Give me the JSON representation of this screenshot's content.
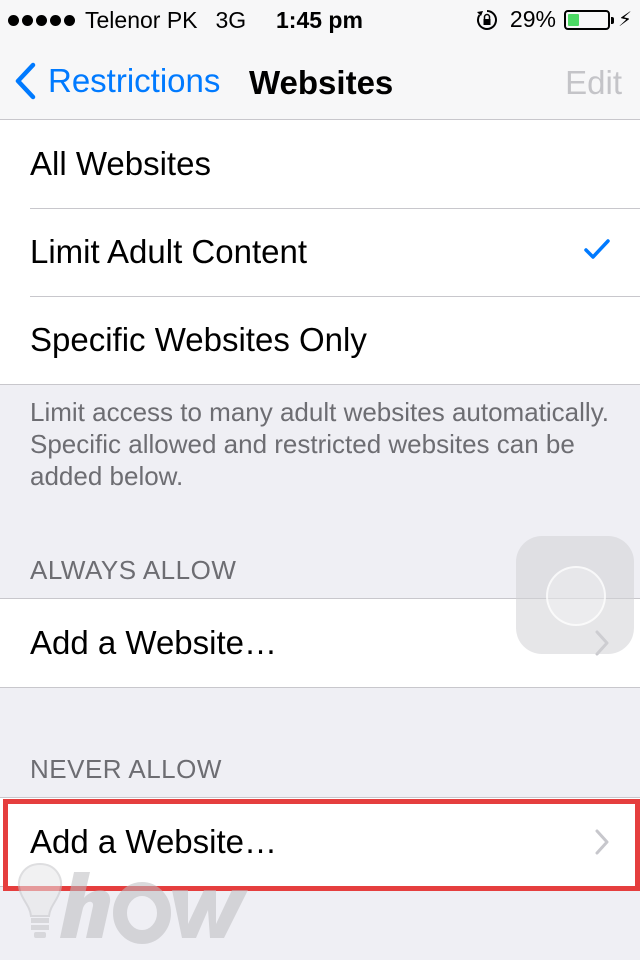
{
  "status_bar": {
    "carrier": "Telenor PK",
    "network": "3G",
    "time": "1:45 pm",
    "battery": "29%",
    "battery_level": 0.29,
    "battery_color": "#4cd964"
  },
  "nav": {
    "back_label": "Restrictions",
    "title": "Websites",
    "edit_label": "Edit"
  },
  "options": [
    {
      "label": "All Websites",
      "checked": false
    },
    {
      "label": "Limit Adult Content",
      "checked": true
    },
    {
      "label": "Specific Websites Only",
      "checked": false
    }
  ],
  "description": "Limit access to many adult websites automatically. Specific allowed and restricted websites can be added below.",
  "always_allow": {
    "header": "ALWAYS ALLOW",
    "add_label": "Add a Website…"
  },
  "never_allow": {
    "header": "NEVER ALLOW",
    "add_label": "Add a Website…"
  },
  "highlight_color": "#e53e3e",
  "accent_color": "#007aff",
  "icons": [
    "signal-dots-icon",
    "rotation-lock-icon",
    "battery-icon",
    "charging-bolt-icon",
    "back-chevron-icon",
    "checkmark-icon",
    "disclosure-chevron-icon",
    "assistive-touch-icon",
    "lightbulb-logo-icon"
  ]
}
